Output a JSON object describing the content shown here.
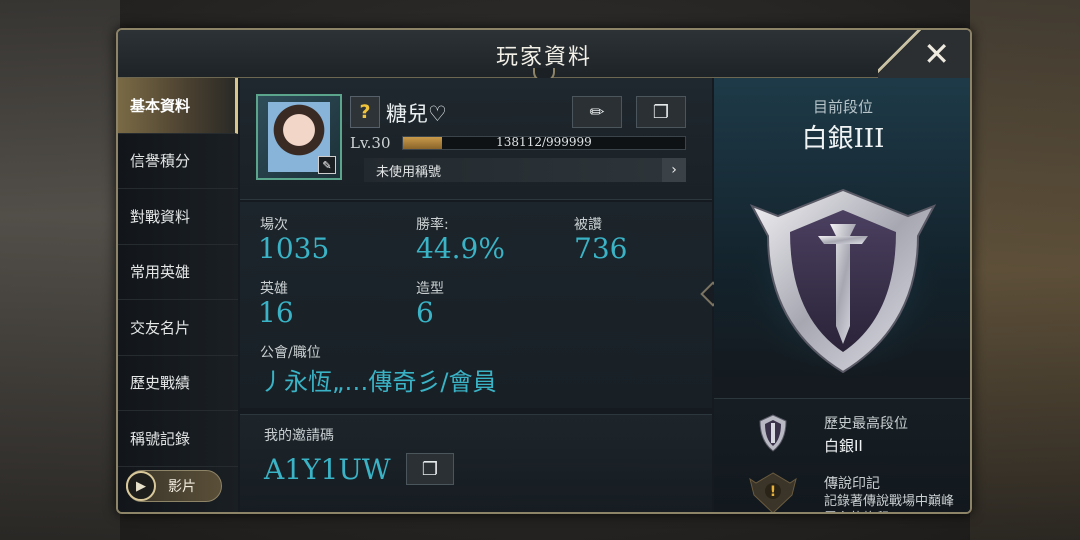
{
  "window": {
    "title": "玩家資料"
  },
  "sidebar": {
    "items": [
      {
        "label": "基本資料",
        "active": true
      },
      {
        "label": "信譽積分",
        "active": false
      },
      {
        "label": "對戰資料",
        "active": false
      },
      {
        "label": "常用英雄",
        "active": false
      },
      {
        "label": "交友名片",
        "active": false
      },
      {
        "label": "歷史戰績",
        "active": false
      },
      {
        "label": "稱號記錄",
        "active": false
      }
    ],
    "video_label": "影片"
  },
  "profile": {
    "rank_symbol": "?",
    "name": "糖兒♡",
    "level": "Lv.30",
    "xp_text": "138112/999999",
    "xp_fraction": 0.138,
    "title_text": "未使用稱號"
  },
  "stats": {
    "matches_label": "場次",
    "matches": "1035",
    "winrate_label": "勝率:",
    "winrate": "44.9%",
    "praised_label": "被讚",
    "praised": "736",
    "heroes_label": "英雄",
    "heroes": "16",
    "skins_label": "造型",
    "skins": "6",
    "guild_label": "公會/職位",
    "guild": "丿永恆„…傳奇彡/會員"
  },
  "invite": {
    "label": "我的邀請碼",
    "code": "A1Y1UW"
  },
  "rank": {
    "current_label": "目前段位",
    "current": "白銀III",
    "highest_label": "歷史最高段位",
    "highest": "白銀II",
    "legend_title": "傳說印記",
    "legend_desc": "記錄著傳說戰場中巔峰霸主的烙印"
  },
  "colors": {
    "accent": "#39b3c5",
    "gold_border": "#8d8367",
    "xp_fill": "#c99a4a"
  }
}
